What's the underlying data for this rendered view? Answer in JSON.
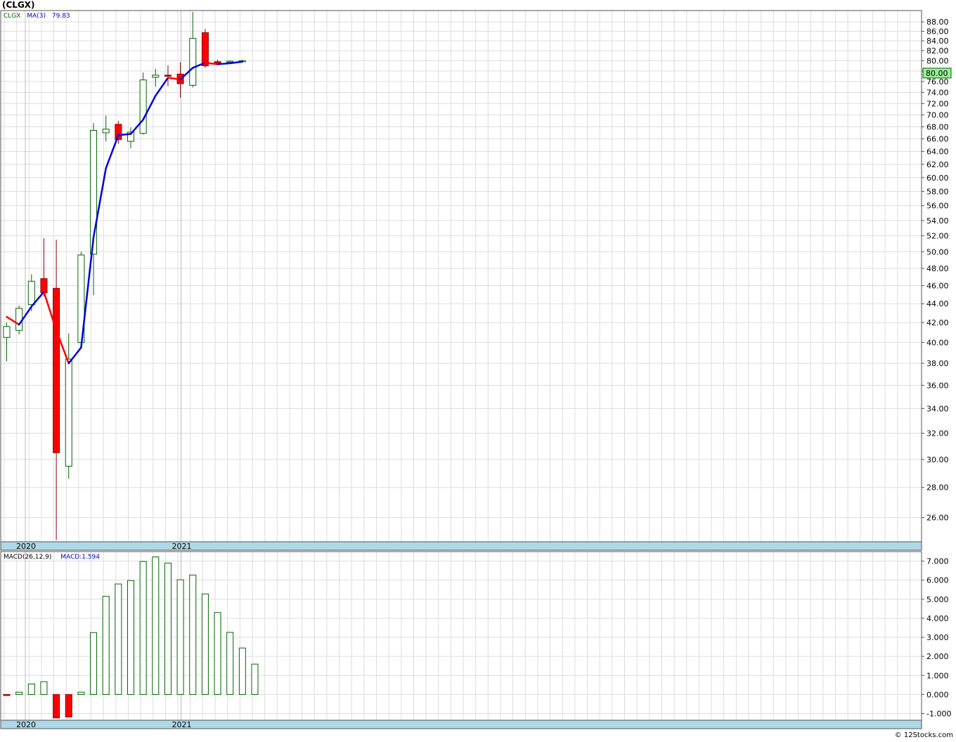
{
  "title": "(CLGX)",
  "footer": "© 12Stocks.com",
  "legend": {
    "symbol": "CLGX",
    "ma_label": "MA(3)",
    "ma_value": "79.83",
    "macd_label": "MACD(26,12,9)",
    "macd_value_label": "MACD:1.594"
  },
  "colors": {
    "up": "#006400",
    "down": "#ff0000",
    "ma_up": "#0000dd",
    "ma_down": "#ff0000",
    "axis_band": "#add8e6",
    "grid": "#dddddd",
    "last_price_box": "#99ee99"
  },
  "chart_data": [
    {
      "type": "candlestick",
      "interval": "monthly",
      "x_labels": [
        "2020",
        "2021"
      ],
      "ylim": [
        24.5,
        90.5
      ],
      "yticks": [
        "26.00",
        "28.00",
        "30.00",
        "32.00",
        "34.00",
        "36.00",
        "38.00",
        "40.00",
        "42.00",
        "44.00",
        "46.00",
        "48.00",
        "50.00",
        "52.00",
        "54.00",
        "56.00",
        "58.00",
        "60.00",
        "62.00",
        "64.00",
        "66.00",
        "68.00",
        "70.00",
        "72.00",
        "74.00",
        "76.00",
        "78.00",
        "80.00",
        "82.00",
        "84.00",
        "86.00",
        "88.00"
      ],
      "last_price": "80.00",
      "candles": [
        {
          "open": 40.5,
          "high": 42.0,
          "low": 38.2,
          "close": 41.6
        },
        {
          "open": 41.2,
          "high": 43.8,
          "low": 40.8,
          "close": 43.5
        },
        {
          "open": 43.9,
          "high": 47.3,
          "low": 43.2,
          "close": 46.5
        },
        {
          "open": 46.8,
          "high": 51.7,
          "low": 44.8,
          "close": 45.2
        },
        {
          "open": 45.7,
          "high": 51.5,
          "low": 24.6,
          "close": 30.5
        },
        {
          "open": 29.5,
          "high": 40.9,
          "low": 28.6,
          "close": 38.4
        },
        {
          "open": 40.0,
          "high": 50.0,
          "low": 39.7,
          "close": 49.6
        },
        {
          "open": 49.7,
          "high": 68.6,
          "low": 44.9,
          "close": 67.4
        },
        {
          "open": 67.0,
          "high": 69.9,
          "low": 65.6,
          "close": 67.6
        },
        {
          "open": 68.4,
          "high": 69.0,
          "low": 65.2,
          "close": 65.9
        },
        {
          "open": 65.6,
          "high": 67.9,
          "low": 64.5,
          "close": 67.1
        },
        {
          "open": 66.9,
          "high": 77.7,
          "low": 66.7,
          "close": 76.3
        },
        {
          "open": 76.8,
          "high": 78.4,
          "low": 75.0,
          "close": 77.2
        },
        {
          "open": 77.2,
          "high": 79.1,
          "low": 75.1,
          "close": 77.1
        },
        {
          "open": 77.4,
          "high": 79.7,
          "low": 73.0,
          "close": 75.6
        },
        {
          "open": 75.3,
          "high": 90.2,
          "low": 74.9,
          "close": 84.5
        },
        {
          "open": 85.7,
          "high": 86.5,
          "low": 78.6,
          "close": 79.0
        },
        {
          "open": 79.8,
          "high": 80.2,
          "low": 79.3,
          "close": 79.5
        },
        {
          "open": 79.7,
          "high": 80.1,
          "low": 79.5,
          "close": 79.9
        },
        {
          "open": 79.8,
          "high": 80.2,
          "low": 79.7,
          "close": 80.0
        }
      ],
      "ma3": [
        42.6,
        41.8,
        43.7,
        45.3,
        41.2,
        38.0,
        39.5,
        51.8,
        61.4,
        66.6,
        66.8,
        69.2,
        73.4,
        76.7,
        76.4,
        78.6,
        79.6,
        79.3,
        79.5,
        79.8
      ]
    },
    {
      "type": "bar",
      "series": [
        {
          "name": "MACD",
          "values": [
            -0.03,
            0.12,
            0.55,
            0.67,
            -1.23,
            -1.18,
            0.12,
            3.25,
            5.15,
            5.8,
            5.98,
            6.98,
            7.22,
            6.9,
            6.02,
            6.27,
            5.28,
            4.3,
            3.26,
            2.44,
            1.594
          ]
        }
      ],
      "ylim": [
        -1.35,
        7.5
      ],
      "yticks": [
        "-1.000",
        "0.000",
        "1.000",
        "2.000",
        "3.000",
        "4.000",
        "5.000",
        "6.000",
        "7.000"
      ],
      "x_labels": [
        "2020",
        "2021"
      ]
    }
  ]
}
